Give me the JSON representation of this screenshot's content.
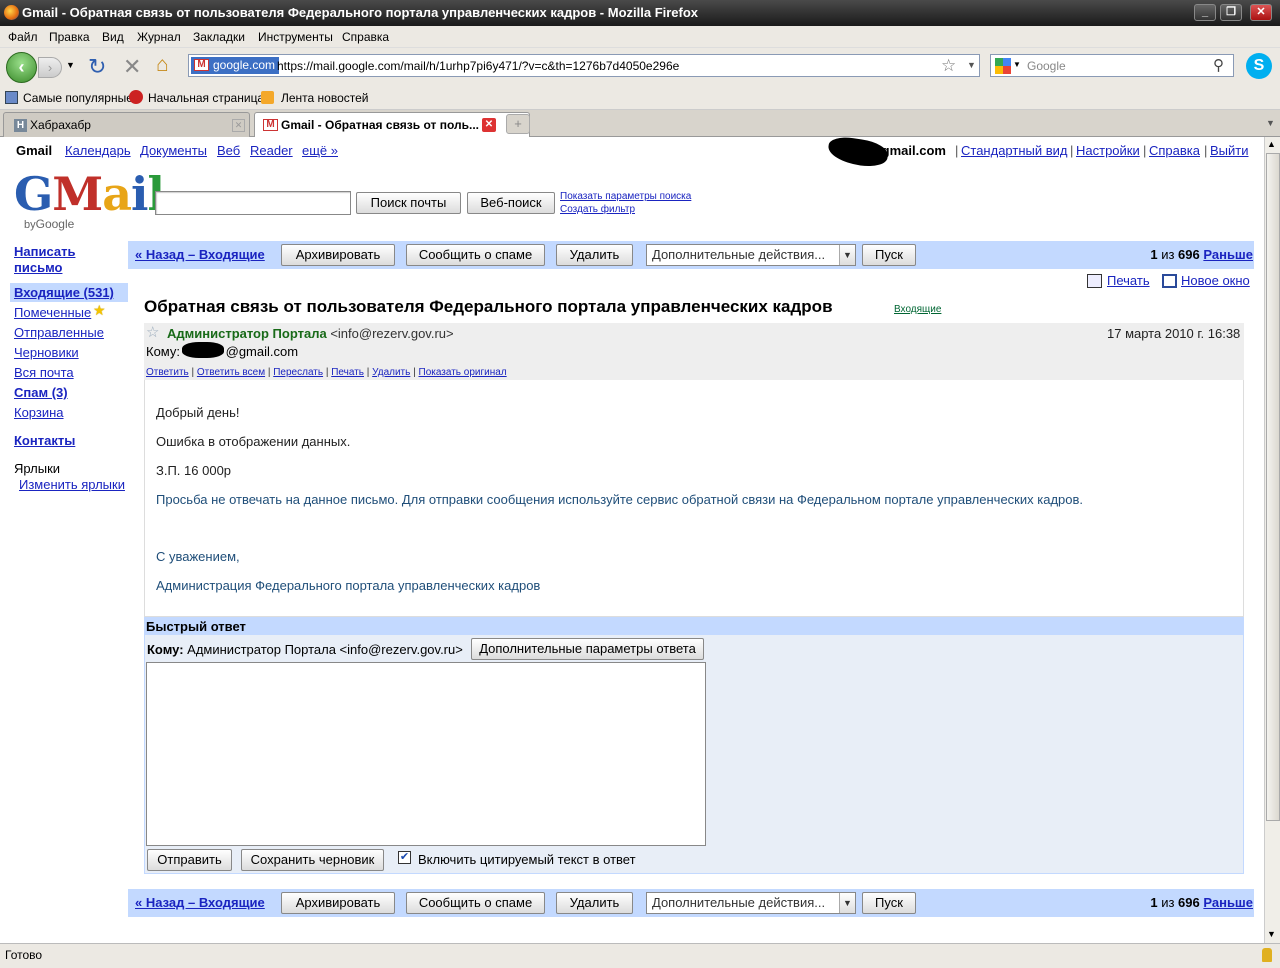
{
  "window": {
    "title": "Gmail - Обратная связь от пользователя Федерального портала управленческих кадров - Mozilla Firefox"
  },
  "menu": [
    "Файл",
    "Правка",
    "Вид",
    "Журнал",
    "Закладки",
    "Инструменты",
    "Справка"
  ],
  "nav": {
    "site_badge": "google.com",
    "url": "https://mail.google.com/mail/h/1urhp7pi6y471/?v=c&th=1276b7d4050e296e",
    "search_placeholder": "Google"
  },
  "bookmarks": [
    "Самые популярные",
    "Начальная страница",
    "Лента новостей"
  ],
  "tabs": [
    {
      "label": "Хабрахабр",
      "active": false
    },
    {
      "label": "Gmail - Обратная связь от поль...",
      "active": true
    }
  ],
  "gmail": {
    "topnav": {
      "gmail": "Gmail",
      "calendar": "Календарь",
      "docs": "Документы",
      "web": "Веб",
      "reader": "Reader",
      "more": "ещё »"
    },
    "account": {
      "email": "@gmail.com",
      "basic_view": "Стандартный вид",
      "settings": "Настройки",
      "help": "Справка",
      "logout": "Выйти"
    },
    "search": {
      "mail_button": "Поиск почты",
      "web_button": "Веб-поиск",
      "show_options": "Показать параметры поиска",
      "create_filter": "Создать фильтр"
    },
    "sidebar": {
      "compose": "Написать письмо",
      "inbox": "Входящие (531)",
      "starred": "Помеченные",
      "sent": "Отправленные",
      "drafts": "Черновики",
      "all": "Вся почта",
      "spam": "Спам (3)",
      "trash": "Корзина",
      "contacts": "Контакты",
      "labels": "Ярлыки",
      "edit_labels": "Изменить ярлыки"
    },
    "toolbar": {
      "back": "« Назад – Входящие",
      "archive": "Архивировать",
      "spam": "Сообщить о спаме",
      "delete": "Удалить",
      "more_actions": "Дополнительные действия...",
      "go": "Пуск",
      "count_pre": "1",
      "count_mid": " из ",
      "count_total": "696",
      "older": "Раньше"
    },
    "print": "Печать",
    "new_window": "Новое окно",
    "message": {
      "subject": "Обратная связь от пользователя Федерального портала управленческих кадров",
      "label": "Входящие",
      "sender_name": "Администратор Портала",
      "sender_email": "<info@rezerv.gov.ru>",
      "date": "17 марта 2010 г. 16:38",
      "to_label": "Кому:",
      "to_value": "@gmail.com",
      "actions": [
        "Ответить",
        "Ответить всем",
        "Переслать",
        "Печать",
        "Удалить",
        "Показать оригинал"
      ],
      "body": [
        "Добрый день!",
        "Ошибка в отображении данных.",
        "З.П. 16 000р",
        "Просьба не отвечать на данное письмо. Для отправки сообщения используйте сервис обратной связи на Федеральном портале управленческих кадров.",
        "С уважением,",
        "Администрация Федерального портала управленческих кадров"
      ]
    },
    "quick_reply": {
      "title": "Быстрый ответ",
      "to_label": "Кому:",
      "to_value": "Администратор Портала <info@rezerv.gov.ru>",
      "more_options": "Дополнительные параметры ответа",
      "send": "Отправить",
      "save_draft": "Сохранить черновик",
      "include_quote": "Включить цитируемый текст в ответ"
    }
  },
  "status": "Готово"
}
